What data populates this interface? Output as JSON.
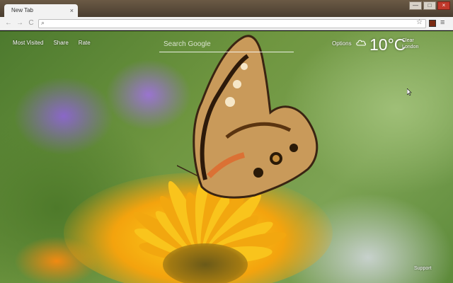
{
  "browser": {
    "tab_title": "New Tab",
    "tab_close": "×",
    "back": "←",
    "forward": "→",
    "reload": "C",
    "star": "☆",
    "menu": "≡",
    "window_minimize": "—",
    "window_maximize": "□",
    "window_close": "×"
  },
  "links": {
    "most_visited": "Most Visited",
    "share": "Share",
    "rate": "Rate"
  },
  "search": {
    "placeholder": "Search Google"
  },
  "options_label": "Options",
  "weather": {
    "temperature": "10°C",
    "condition": "Clear",
    "location": "London",
    "icon": "cloud-icon"
  },
  "support_label": "Support",
  "colors": {
    "accent_petal": "#f7b514",
    "chrome_bg": "#f2f2f2"
  }
}
